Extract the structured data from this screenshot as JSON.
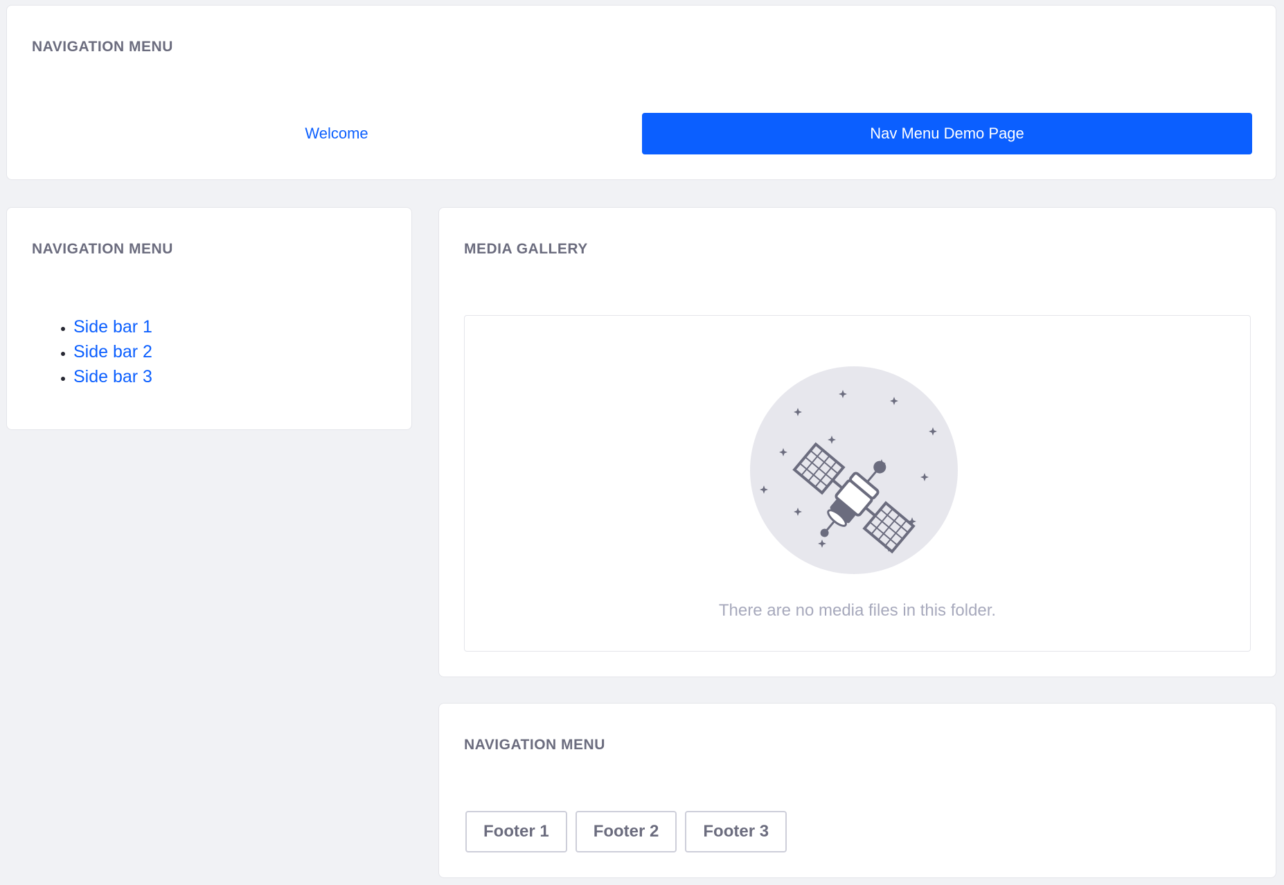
{
  "top_nav": {
    "title": "NAVIGATION MENU",
    "items": [
      {
        "label": "Welcome"
      },
      {
        "label": "Nav Menu Demo Page"
      }
    ]
  },
  "side_nav": {
    "title": "NAVIGATION MENU",
    "items": [
      {
        "label": "Side bar 1"
      },
      {
        "label": "Side bar 2"
      },
      {
        "label": "Side bar 3"
      }
    ]
  },
  "media_gallery": {
    "title": "MEDIA GALLERY",
    "empty_message": "There are no media files in this folder.",
    "empty_icon": "satellite-icon"
  },
  "footer_nav": {
    "title": "NAVIGATION MENU",
    "items": [
      {
        "label": "Footer 1"
      },
      {
        "label": "Footer 2"
      },
      {
        "label": "Footer 3"
      }
    ]
  },
  "colors": {
    "accent": "#0b5fff",
    "background": "#f1f2f5",
    "muted_text": "#6b6c7e",
    "empty_text": "#a7a9bc"
  }
}
